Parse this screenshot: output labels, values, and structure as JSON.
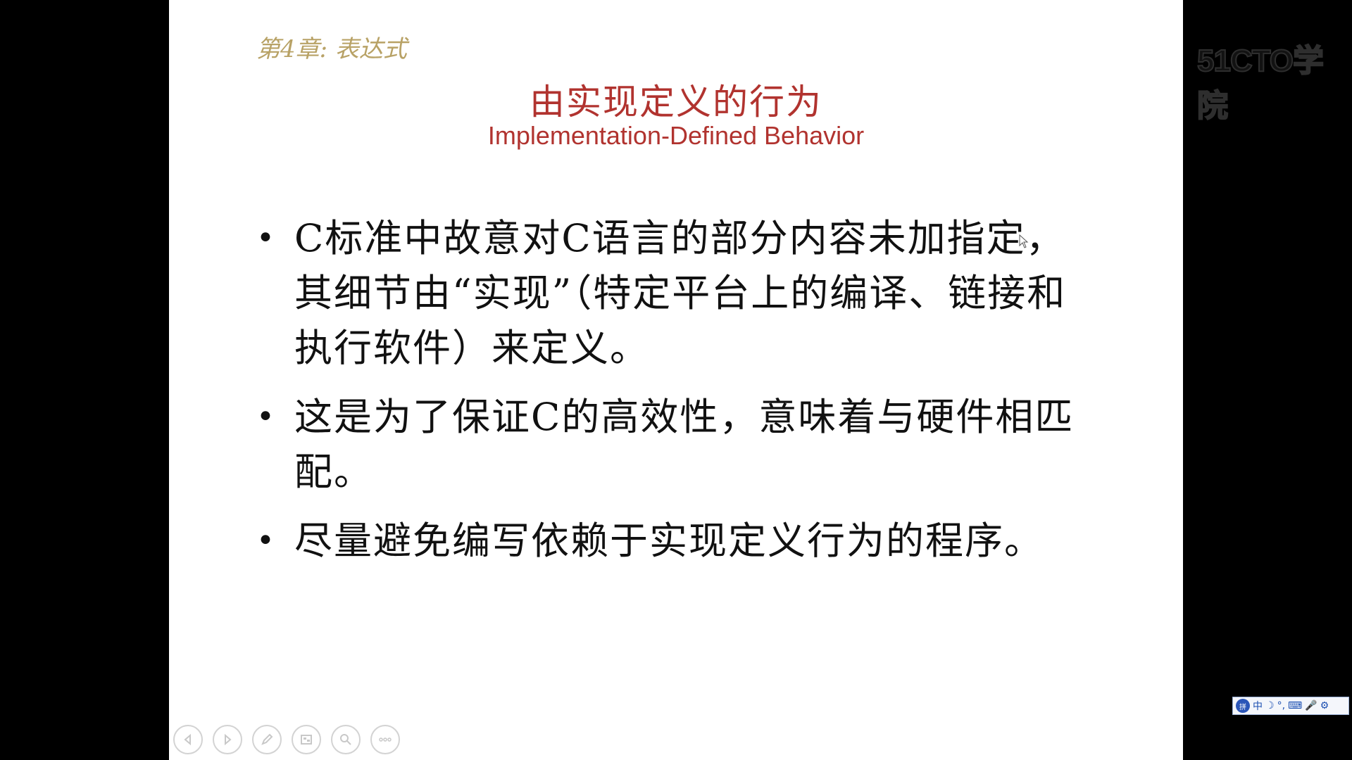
{
  "slide": {
    "chapter": "第4章: 表达式",
    "title_cn": "由实现定义的行为",
    "title_en": "Implementation-Defined Behavior",
    "bullet_symbol": "•",
    "bullets": [
      "C标准中故意对C语言的部分内容未加指定，其细节由“实现”（特定平台上的编译、链接和执行软件）来定义。",
      "这是为了保证C的高效性，意味着与硬件相匹配。",
      "尽量避免编写依赖于实现定义行为的程序。"
    ]
  },
  "watermark": "51CTO学院",
  "controls": [
    {
      "name": "previous",
      "icon": "arrow-left-icon"
    },
    {
      "name": "next",
      "icon": "arrow-right-icon"
    },
    {
      "name": "pen",
      "icon": "pen-icon"
    },
    {
      "name": "slides",
      "icon": "slides-grid-icon"
    },
    {
      "name": "zoom",
      "icon": "magnifier-icon"
    },
    {
      "name": "more",
      "icon": "more-dots-icon"
    }
  ],
  "ime": {
    "logo": "拼",
    "lang": "中",
    "items": [
      "☽",
      "°,",
      "⌨",
      "🎤",
      "⚙"
    ]
  },
  "colors": {
    "title": "#b1332f",
    "chapter": "#b8a266",
    "body_text": "#111111",
    "background": "#ffffff",
    "frame": "#000000"
  }
}
